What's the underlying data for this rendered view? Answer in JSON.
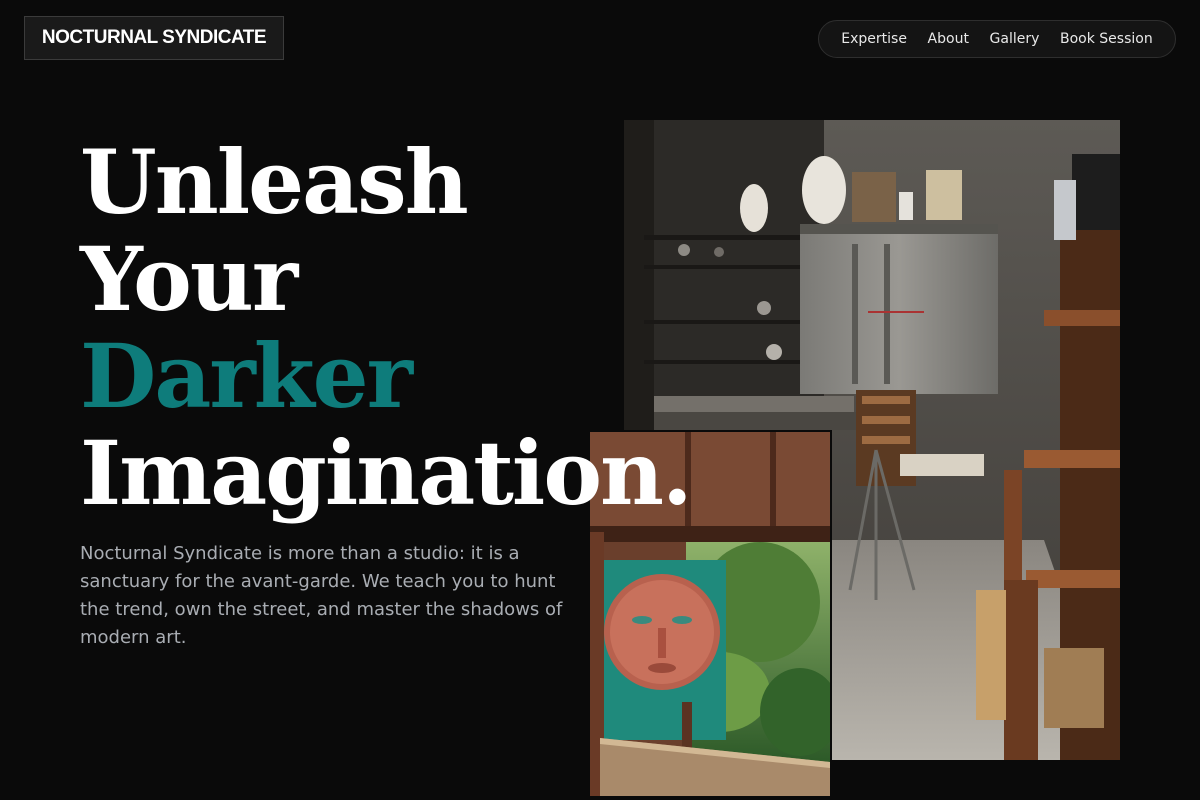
{
  "brand": {
    "name": "NOCTURNAL SYNDICATE"
  },
  "nav": {
    "items": [
      {
        "label": "Expertise"
      },
      {
        "label": "About"
      },
      {
        "label": "Gallery"
      },
      {
        "label": "Book Session"
      }
    ]
  },
  "hero": {
    "title_lines": [
      "Unleash",
      "Your",
      "Darker",
      "Imagination."
    ],
    "accent_color": "#0e7c7b",
    "body": "Nocturnal Syndicate is more than a studio: it is a sanctuary for the avant-garde. We teach you to hunt the trend, own the street, and master the shadows of modern art."
  },
  "colors": {
    "background": "#0a0a0a",
    "text_muted": "#a9adb3"
  }
}
